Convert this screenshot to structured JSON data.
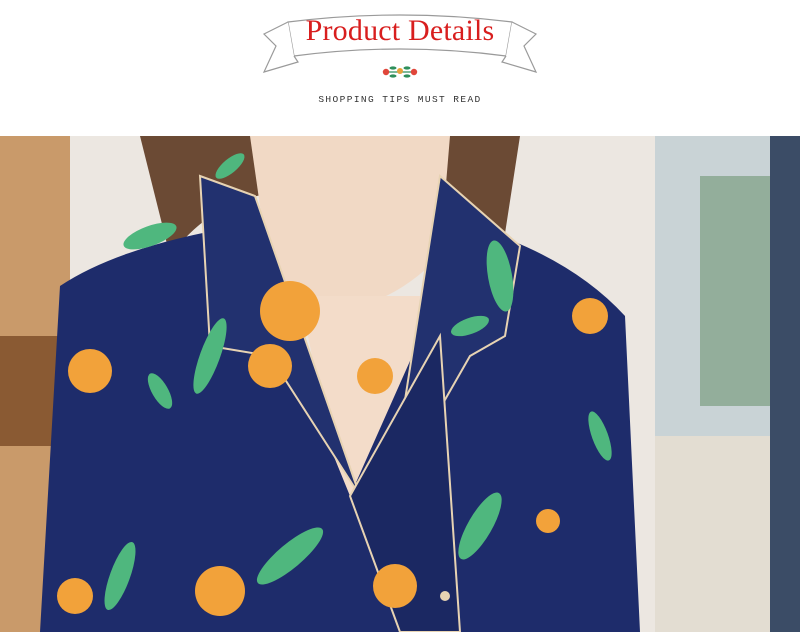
{
  "header": {
    "title": "Product Details",
    "subtitle": "SHOPPING TIPS MUST READ",
    "accent_color": "#d81e1e"
  },
  "photo": {
    "description_icon": "product-photo-image",
    "shirt_color": "#1e2c6b",
    "fruit_color": "#f2a23a",
    "leaf_color": "#4fb77e",
    "piping_color": "#e7d3b3"
  }
}
